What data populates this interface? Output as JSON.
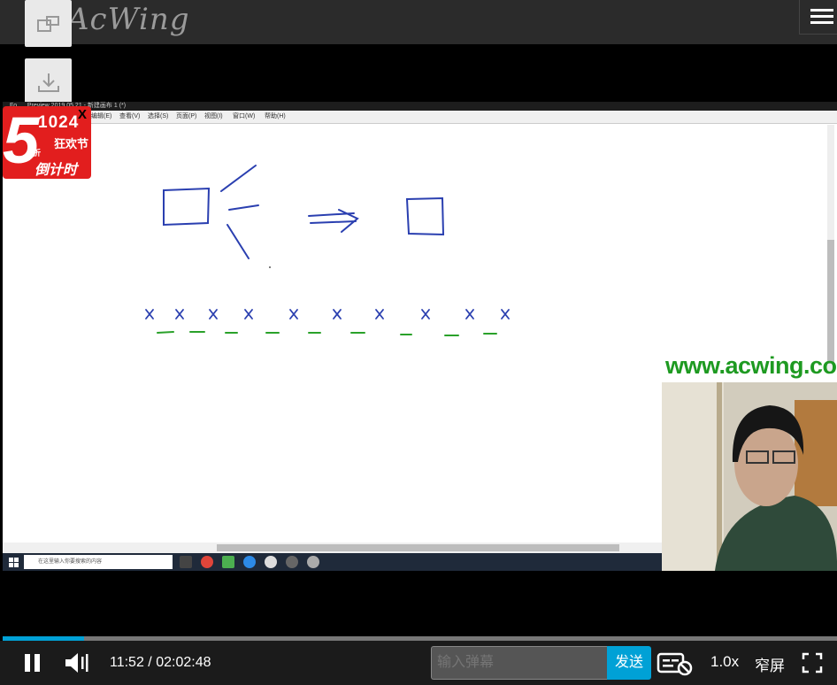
{
  "site": {
    "logo_text": "AcWing"
  },
  "sidebar_buttons": [
    {
      "icon": "picture-in-picture-icon"
    },
    {
      "icon": "download-icon"
    }
  ],
  "video": {
    "app_title": "Fo..... Preview 2019.05.21 - 新建画布 1 (*)",
    "menu_items": [
      "编辑(E)",
      "查看(V)",
      "选择(S)",
      "页面(P)",
      "视图(I)",
      "窗口(W)",
      "帮助(H)"
    ],
    "taskbar_search_placeholder": "在这里输入你要搜索的内容",
    "watermark_url": "www.acwing.com"
  },
  "ad": {
    "big_digit": "5",
    "number": "1024",
    "discount_char": "折",
    "festival": "狂欢节",
    "countdown": "倒计时",
    "close_label": "X"
  },
  "player": {
    "progress": 0.0973,
    "current_time": "11:52",
    "total_time": "02:02:48",
    "time_separator": " / ",
    "danmaku_placeholder": "输入弹幕",
    "send_label": "发送",
    "speed": "1.0x",
    "screen_mode": "窄屏"
  },
  "colors": {
    "accent": "#00a1d6",
    "watermark": "#1e9a21",
    "ink": "#2a3fb0",
    "green_ink": "#2aa12a"
  }
}
